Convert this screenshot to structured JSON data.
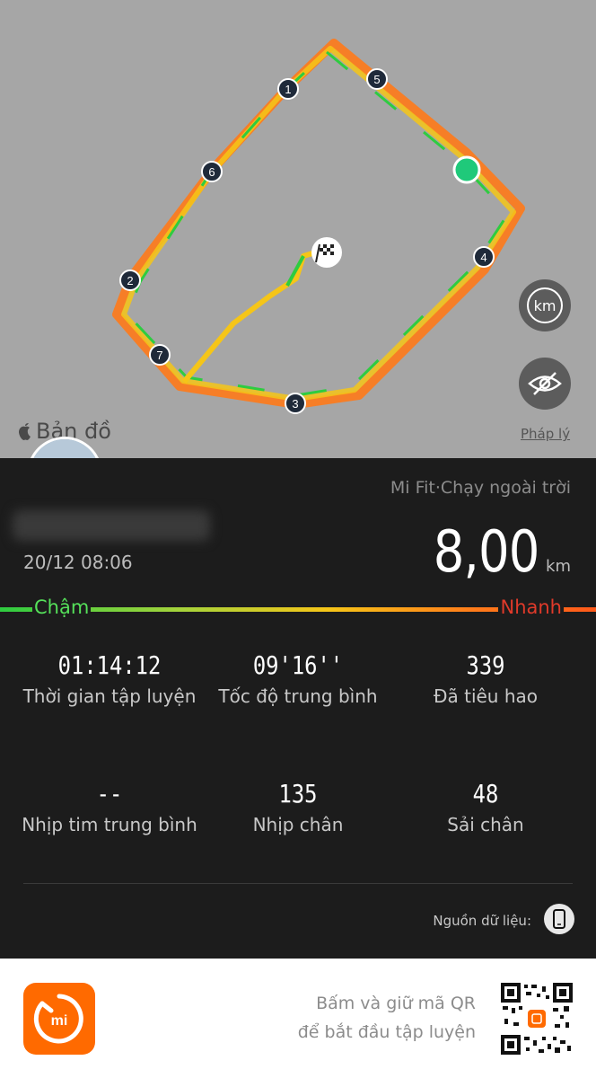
{
  "map": {
    "brand_label": "Bản đồ",
    "legal_link": "Pháp lý",
    "km_button_label": "km",
    "markers": [
      "1",
      "2",
      "3",
      "4",
      "5",
      "6",
      "7"
    ]
  },
  "workout": {
    "source": "Mi Fit·Chạy ngoài trời",
    "datetime": "20/12 08:06",
    "distance_value": "8,00",
    "distance_unit": "km"
  },
  "speed_scale": {
    "slow": "Chậm",
    "fast": "Nhanh"
  },
  "stats": [
    {
      "value": "01:14:12",
      "label": "Thời gian tập luyện"
    },
    {
      "value": "09'16''",
      "label": "Tốc độ trung bình"
    },
    {
      "value": "339",
      "label": "Đã tiêu hao"
    },
    {
      "value": "--",
      "label": "Nhịp tim trung bình"
    },
    {
      "value": "135",
      "label": "Nhịp chân"
    },
    {
      "value": "48",
      "label": "Sải chân"
    }
  ],
  "data_source_label": "Nguồn dữ liệu:",
  "footer": {
    "line1": "Bấm và giữ mã QR",
    "line2": "để bắt đầu tập luyện",
    "logo_text": "mi"
  },
  "colors": {
    "slow": "#2ecc40",
    "mid": "#f5c518",
    "fast": "#ff5a1a",
    "brand": "#ff6a00"
  }
}
